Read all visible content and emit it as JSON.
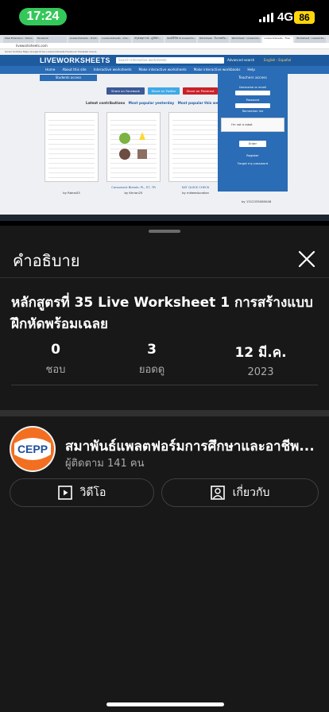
{
  "status_bar": {
    "time": "17:24",
    "network": "4G",
    "battery": "86"
  },
  "video": {
    "browser_tabs": [
      "Pixel Extension - Tutors",
      "Facebook",
      "Liveworksheets - Pract...",
      "Liveworksheets - Inte...",
      "สรุปเหตุการณ์ - ดูวิธีทำ...",
      "สอนวิธีใช้งาน Liveworks...",
      "Worksheet - ใบงานพร้อ...",
      "Worksheet - Liveworks...",
      "Liveworksheets - Free",
      "Worksheet - Liveworks..."
    ],
    "url": "liveworksheets.com",
    "bookmarks": "Gmail   YouTube   Maps   Google Drive   Liveworksheets   Facebook   Translate   Canva",
    "site_logo": "LIVEWORKSHEETS",
    "search_placeholder": "Search interactive worksheets",
    "advanced_search": "Advanced search",
    "language": "English - Español",
    "nav_items": [
      "Home",
      "About this site",
      "Interactive worksheets",
      "Make interactive worksheets",
      "Make interactive workbooks",
      "Help"
    ],
    "students_access": "Students access",
    "share_facebook": "Share on Facebook",
    "share_twitter": "Share on Twitter",
    "share_pinterest": "Share on Pinterest",
    "latest_contributions": "Latest contributions",
    "most_popular_yesterday": "Most popular yesterday",
    "most_popular_week": "Most popular this week",
    "worksheets": [
      {
        "title": "",
        "author": "Rahal43"
      },
      {
        "title": "Consonant Blends: PL, ST, TR",
        "author": "Khrian25"
      },
      {
        "title": "SAT QUICK CHECK",
        "author": "mikeeducation"
      }
    ],
    "teachers_access": "Teachers access",
    "username_label": "Username or email",
    "password_label": "Password",
    "remember_me": "Remember me",
    "not_robot": "I'm not a robot",
    "enter_btn": "Enter",
    "register": "Register",
    "forgot_password": "Forgot my password",
    "phone": "by 1312335080048"
  },
  "sheet": {
    "heading": "คำอธิบาย",
    "title": "หลักสูตรที่ 35 Live Worksheet 1 การสร้างแบบฝึกหัดพร้อมเฉลย",
    "stats": [
      {
        "value": "0",
        "label": "ชอบ"
      },
      {
        "value": "3",
        "label": "ยอดดู"
      },
      {
        "value": "12 มี.ค.",
        "label": "2023"
      }
    ],
    "channel": {
      "name": "สมาพันธ์แพลตฟอร์มการศึกษาและอาชีพ...",
      "subscribers": "ผู้ติดตาม 141 คน",
      "logo_text": "CEPP"
    },
    "buttons": {
      "videos": "วิดีโอ",
      "about": "เกี่ยวกับ"
    }
  },
  "colors": {
    "background": "#181818",
    "status_time": "#34c759",
    "battery": "#ffd60a",
    "lw_blue": "#2a6cb5",
    "cepp_orange": "#f26f21",
    "cepp_blue": "#1e4f9c"
  }
}
